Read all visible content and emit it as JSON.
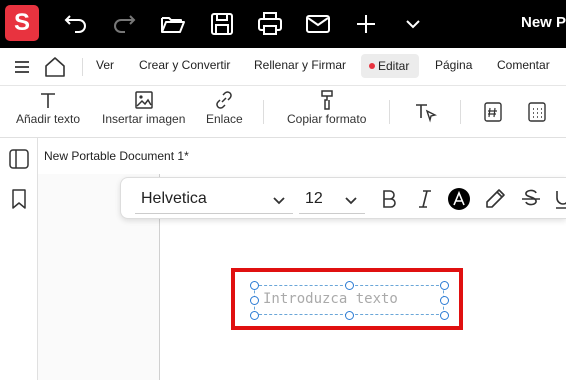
{
  "app": {
    "logo_letter": "S",
    "logo_color": "#e8333f",
    "document_title": "New Po",
    "titlebar_icons": [
      "undo-icon",
      "redo-icon",
      "open-folder-icon",
      "save-icon",
      "print-icon",
      "mail-icon",
      "plus-icon",
      "chevron-down-icon"
    ]
  },
  "menubar": {
    "items": [
      "Ver",
      "Crear y Convertir",
      "Rellenar y Firmar",
      "Editar",
      "Página",
      "Comentar"
    ],
    "active": "Editar"
  },
  "toolbar": {
    "add_text": "Añadir texto",
    "insert_image": "Insertar imagen",
    "link": "Enlace",
    "copy_format": "Copiar formato"
  },
  "tab": {
    "label": "New Portable Document 1*"
  },
  "format": {
    "font": "Helvetica",
    "size": "12",
    "color": "#000000"
  },
  "textbox": {
    "placeholder": "Introduzca texto"
  },
  "accent": "#e01010"
}
